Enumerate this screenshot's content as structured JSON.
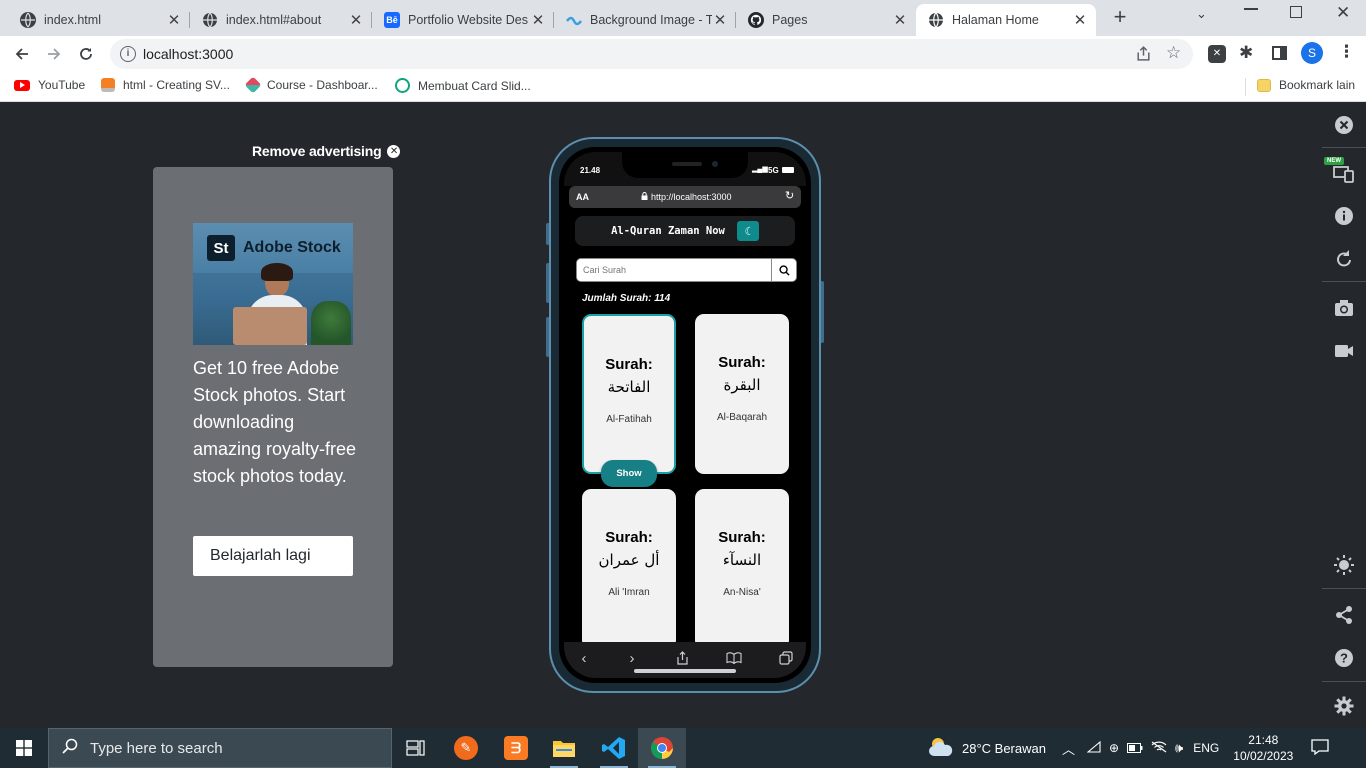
{
  "browser": {
    "tabs": [
      {
        "title": "index.html",
        "favicon": "globe-icon",
        "active": false
      },
      {
        "title": "index.html#about",
        "favicon": "globe-icon",
        "active": false
      },
      {
        "title": "Portfolio Website Des",
        "favicon": "behance-icon",
        "active": false
      },
      {
        "title": "Background Image - T",
        "favicon": "wave-icon",
        "active": false
      },
      {
        "title": "Pages",
        "favicon": "github-icon",
        "active": false
      },
      {
        "title": "Halaman Home",
        "favicon": "globe-icon",
        "active": true
      }
    ],
    "new_tab_label": "+",
    "url": "localhost:3000",
    "profile_initial": "S",
    "bookmarks": [
      {
        "label": "YouTube",
        "icon": "youtube-icon",
        "color": "#ff0000"
      },
      {
        "label": "html - Creating SV...",
        "icon": "stackoverflow-icon",
        "color": "#f48024"
      },
      {
        "label": "Course - Dashboar...",
        "icon": "course-icon",
        "color": "#e0495f"
      },
      {
        "label": "Membuat Card Slid...",
        "icon": "chatgpt-icon",
        "color": "#10a37f"
      }
    ],
    "other_bookmarks": "Bookmark lain"
  },
  "ad": {
    "remove_label": "Remove advertising",
    "brand_badge": "St",
    "brand_name": "Adobe Stock",
    "body": "Get 10 free Adobe Stock photos. Start downloading amazing royalty-free stock photos today.",
    "cta": "Belajarlah lagi"
  },
  "phone": {
    "time": "21.48",
    "network": "5G",
    "text_size": "AA",
    "url": "http://localhost:3000",
    "app": {
      "title": "Al-Quran Zaman Now",
      "search_placeholder": "Cari Surah",
      "count_label": "Jumlah Surah: 114",
      "surahs": [
        {
          "label": "Surah:",
          "arabic": "الفاتحة",
          "latin": "Al-Fatihah"
        },
        {
          "label": "Surah:",
          "arabic": "البقرة",
          "latin": "Al-Baqarah"
        },
        {
          "label": "Surah:",
          "arabic": "أل عمران",
          "latin": "Ali 'Imran"
        },
        {
          "label": "Surah:",
          "arabic": "النسآء",
          "latin": "An-Nisa'"
        }
      ],
      "show_label": "Show"
    }
  },
  "rail": {
    "new_badge": "NEW"
  },
  "taskbar": {
    "search_placeholder": "Type here to search",
    "weather": "28°C  Berawan",
    "language": "ENG",
    "time": "21:48",
    "date": "10/02/2023"
  },
  "colors": {
    "page_bg": "#24282d",
    "accent_teal": "#177f86",
    "ad_panel": "#6b6e72"
  }
}
